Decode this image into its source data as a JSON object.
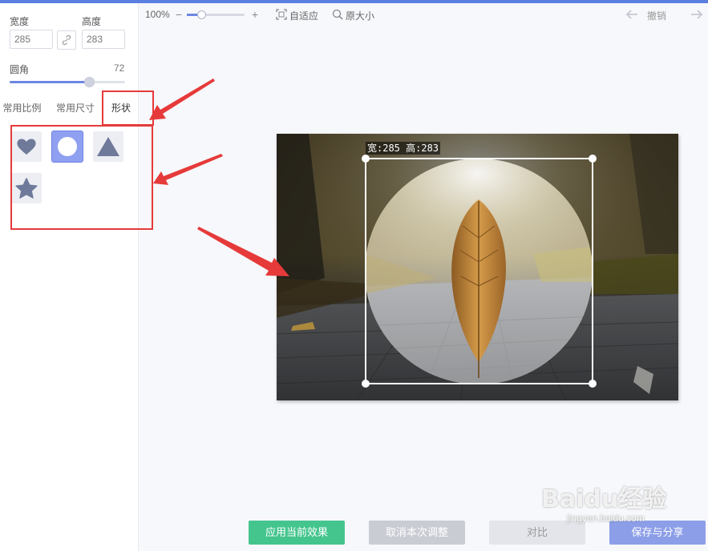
{
  "sidebar": {
    "width_label": "宽度",
    "height_label": "高度",
    "width_value": "285",
    "height_value": "283",
    "radius_label": "圆角",
    "radius_value": "72",
    "radius_level": 0.69,
    "tabs": [
      {
        "label": "常用比例"
      },
      {
        "label": "常用尺寸"
      },
      {
        "label": "形状"
      }
    ],
    "active_tab": "形状",
    "shapes": [
      "heart-icon",
      "circle-icon",
      "triangle-icon",
      "star-icon"
    ],
    "selected_shape": "circle-icon"
  },
  "toolbar": {
    "zoom_label": "100%",
    "zoom_level": 0.25,
    "fit_label": "自适应",
    "original_label": "原大小",
    "undo_label": "撤销"
  },
  "canvas": {
    "dimension_label": "宽:285 高:283",
    "crop_shape": "circle"
  },
  "actions": {
    "apply_label": "应用当前效果",
    "cancel_label": "取消本次调整",
    "compare_label": "对比",
    "save_label": "保存与分享"
  },
  "watermark": {
    "brand": "Baidu经验",
    "site": "jingyan.baidu.com"
  },
  "colors": {
    "accent": "#6d86e4",
    "apply": "#45c58e",
    "annotation": "#e63a3a"
  }
}
